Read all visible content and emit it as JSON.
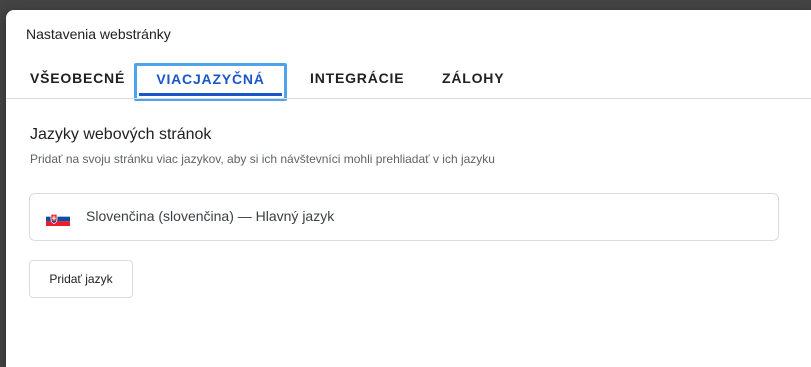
{
  "dialog": {
    "title": "Nastavenia webstránky"
  },
  "tabs": [
    {
      "label": "VŠEOBECNÉ",
      "active": false
    },
    {
      "label": "VIACJAZYČNÁ",
      "active": true
    },
    {
      "label": "INTEGRÁCIE",
      "active": false
    },
    {
      "label": "ZÁLOHY",
      "active": false
    }
  ],
  "section": {
    "title": "Jazyky webových stránok",
    "description": "Pridať na svoju stránku viac jazykov, aby si ich návštevníci mohli prehliadať v ich jazyku"
  },
  "languages": [
    {
      "label": "Slovenčina (slovenčina) — Hlavný jazyk",
      "flag": "slovakia-flag-icon"
    }
  ],
  "actions": {
    "add_language": "Pridať jazyk"
  },
  "colors": {
    "accent": "#1a56c9",
    "focus_ring": "#4fa3ec"
  }
}
